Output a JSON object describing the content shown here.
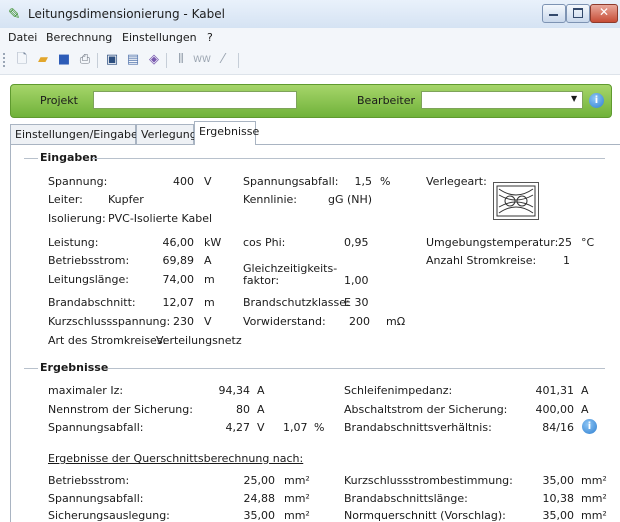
{
  "window": {
    "title": "Leitungsdimensionierung - Kabel",
    "app_icon": "pencil-icon"
  },
  "menu": [
    "Datei",
    "Berechnung",
    "Einstellungen",
    "?"
  ],
  "toolbar_icons": [
    "new-file-icon",
    "open-folder-icon",
    "save-icon",
    "print-icon",
    "lock-icon",
    "document-icon",
    "cable-icon",
    "separator-icon",
    "tool-a-icon",
    "tool-b-icon"
  ],
  "project": {
    "project_label": "Projekt",
    "project_value": "",
    "editor_label": "Bearbeiter",
    "editor_value": "",
    "info_icon": "i"
  },
  "tabs": [
    "Einstellungen/Eingaben",
    "Verlegung",
    "Ergebnisse"
  ],
  "active_tab": "Ergebnisse",
  "inputs": {
    "heading": "Eingaben",
    "spannung": {
      "label": "Spannung:",
      "value": "400",
      "unit": "V"
    },
    "leiter": {
      "label": "Leiter:",
      "value": "Kupfer"
    },
    "isolierung": {
      "label": "Isolierung:",
      "value": "PVC-Isolierte Kabel"
    },
    "leistung": {
      "label": "Leistung:",
      "value": "46,00",
      "unit": "kW"
    },
    "betriebsstrom": {
      "label": "Betriebsstrom:",
      "value": "69,89",
      "unit": "A"
    },
    "leitungslaenge": {
      "label": "Leitungslänge:",
      "value": "74,00",
      "unit": "m"
    },
    "brandabschnitt": {
      "label": "Brandabschnitt:",
      "value": "12,07",
      "unit": "m"
    },
    "kurzschlussspannung": {
      "label": "Kurzschlussspannung:",
      "value": "230",
      "unit": "V"
    },
    "stromkreis": {
      "label": "Art des Stromkreises:",
      "value": "Verteilungsnetz"
    },
    "spannungsabfall": {
      "label": "Spannungsabfall:",
      "value": "1,5",
      "unit": "%"
    },
    "kennlinie": {
      "label": "Kennlinie:",
      "value": "gG (NH)"
    },
    "cosphi": {
      "label": "cos Phi:",
      "value": "0,95"
    },
    "gleichzeitigkeit": {
      "label_1": "Gleichzeitigkeits-",
      "label_2": "faktor:",
      "value": "1,00"
    },
    "brandschutzklasse": {
      "label": "Brandschutzklasse:",
      "value": "E 30"
    },
    "vorwiderstand": {
      "label": "Vorwiderstand:",
      "value": "200",
      "unit": "mΩ"
    },
    "verlegeart": {
      "label": "Verlegeart:"
    },
    "umgebungstemperatur": {
      "label": "Umgebungstemperatur:",
      "value": "25",
      "unit": "°C"
    },
    "stromkreise": {
      "label": "Anzahl Stromkreise:",
      "value": "1"
    }
  },
  "results": {
    "heading": "Ergebnisse",
    "max_iz": {
      "label": "maximaler Iz:",
      "value": "94,34",
      "unit": "A"
    },
    "nennstrom": {
      "label": "Nennstrom der Sicherung:",
      "value": "80",
      "unit": "A"
    },
    "spannungsabfall": {
      "label": "Spannungsabfall:",
      "value": "4,27",
      "unit": "V",
      "value2": "1,07",
      "unit2": "%"
    },
    "schleifenimpedanz": {
      "label": "Schleifenimpedanz:",
      "value": "401,31",
      "unit": "A"
    },
    "abschaltstrom": {
      "label": "Abschaltstrom der Sicherung:",
      "value": "400,00",
      "unit": "A"
    },
    "brandverhaeltnis": {
      "label": "Brandabschnittsverhältnis:",
      "value": "84/16"
    },
    "cross_heading": "Ergebnisse der Querschnittsberechnung nach:",
    "cross": [
      {
        "label": "Betriebsstrom:",
        "value": "25,00",
        "unit": "mm²",
        "label2": "Kurzschlussstrombestimmung:",
        "value2": "35,00",
        "unit2": "mm²"
      },
      {
        "label": "Spannungsabfall:",
        "value": "24,88",
        "unit": "mm²",
        "label2": "Brandabschnittslänge:",
        "value2": "10,38",
        "unit2": "mm²"
      },
      {
        "label": "Sicherungsauslegung:",
        "value": "35,00",
        "unit": "mm²",
        "label2": "Normquerschnitt (Vorschlag):",
        "value2": "35,00",
        "unit2": "mm²"
      }
    ]
  }
}
